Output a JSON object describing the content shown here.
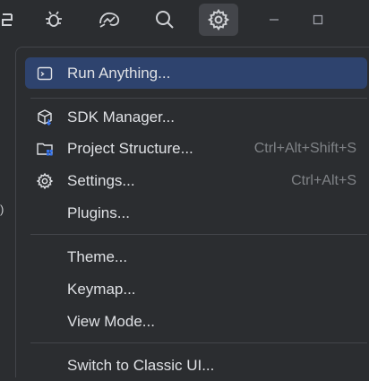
{
  "toolbar": {
    "icons": [
      "partial-logo-icon",
      "debug-icon",
      "profiler-icon",
      "search-icon",
      "settings-icon"
    ],
    "window_controls": [
      "minimize-icon",
      "maximize-icon"
    ]
  },
  "left_strip": {
    "glyph": ")"
  },
  "menu": {
    "items": [
      {
        "label": "Run Anything...",
        "shortcut": "",
        "icon": "run-anything-icon",
        "selected": true
      },
      {
        "label": "SDK Manager...",
        "shortcut": "",
        "icon": "sdk-cube-icon"
      },
      {
        "label": "Project Structure...",
        "shortcut": "Ctrl+Alt+Shift+S",
        "icon": "folder-grid-icon"
      },
      {
        "label": "Settings...",
        "shortcut": "Ctrl+Alt+S",
        "icon": "gear-icon"
      },
      {
        "label": "Plugins...",
        "shortcut": ""
      },
      {
        "label": "Theme...",
        "shortcut": ""
      },
      {
        "label": "Keymap...",
        "shortcut": ""
      },
      {
        "label": "View Mode...",
        "shortcut": ""
      },
      {
        "label": "Switch to Classic UI...",
        "shortcut": ""
      }
    ]
  },
  "colors": {
    "background": "#2b2d30",
    "selection": "#2e436e",
    "text": "#dfe1e5",
    "shortcut": "#7f8286",
    "accent": "#3574f0"
  }
}
